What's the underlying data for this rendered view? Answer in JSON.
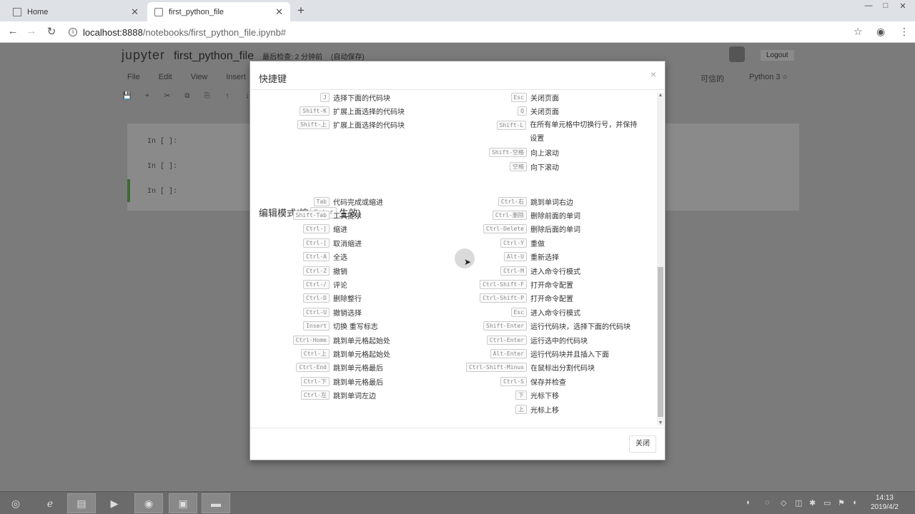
{
  "browser": {
    "tabs": [
      {
        "label": "Home",
        "active": false
      },
      {
        "label": "first_python_file",
        "active": true
      }
    ],
    "new_tab": "+",
    "url_host": "localhost:8888",
    "url_path": "/notebooks/first_python_file.ipynb#",
    "nav": {
      "back": "←",
      "forward": "→",
      "reload": "↻"
    },
    "icons": {
      "star": "☆",
      "account": "◉",
      "menu": "⋮"
    },
    "window_controls": {
      "minimize": "—",
      "maximize": "□",
      "close": "✕"
    }
  },
  "jupyter": {
    "logo": "jupyter",
    "notebook_name": "first_python_file",
    "checkpoint": "最后检查: 2 分钟前",
    "autosave": "(自动保存)",
    "logout": "Logout",
    "menu": [
      "File",
      "Edit",
      "View",
      "Insert"
    ],
    "kernel_status": "可信的",
    "kernel_name": "Python 3",
    "toolbar_icons": [
      "💾",
      "+",
      "✂",
      "⧉",
      "⎘",
      "↑",
      "↓"
    ],
    "cell_prompts": [
      "In [ ]:",
      "In [ ]:",
      "In [ ]:"
    ]
  },
  "modal": {
    "title": "快捷键",
    "close_x": "×",
    "close_button": "关闭",
    "edit_mode_title_prefix": "编辑模式(按",
    "edit_mode_key": "Enter",
    "edit_mode_title_suffix": "生效)",
    "command_left": [
      {
        "key": "J",
        "desc": "选择下面的代码块"
      },
      {
        "key": "Shift-K",
        "desc": "扩展上面选择的代码块"
      },
      {
        "key": "Shift-上",
        "desc": "扩展上面选择的代码块"
      }
    ],
    "command_right": [
      {
        "key": "Esc",
        "desc": "关闭页面"
      },
      {
        "key": "Q",
        "desc": "关闭页面"
      },
      {
        "key": "Shift-L",
        "desc": "在所有单元格中切换行号，并保持设置"
      },
      {
        "key": "Shift-空格",
        "desc": "向上滚动"
      },
      {
        "key": "空格",
        "desc": "向下滚动"
      }
    ],
    "edit_left": [
      {
        "key": "Tab",
        "desc": "代码完成或缩进"
      },
      {
        "key": "Shift-Tab",
        "desc": "工具提示"
      },
      {
        "key": "Ctrl-]",
        "desc": "缩进"
      },
      {
        "key": "Ctrl-[",
        "desc": "取消缩进"
      },
      {
        "key": "Ctrl-A",
        "desc": "全选"
      },
      {
        "key": "Ctrl-Z",
        "desc": "撤销"
      },
      {
        "key": "Ctrl-/",
        "desc": "评论"
      },
      {
        "key": "Ctrl-D",
        "desc": "删除整行"
      },
      {
        "key": "Ctrl-U",
        "desc": "撤销选择"
      },
      {
        "key": "Insert",
        "desc": "切换 重写标志"
      },
      {
        "key": "Ctrl-Home",
        "desc": "跳到单元格起始处"
      },
      {
        "key": "Ctrl-上",
        "desc": "跳到单元格起始处"
      },
      {
        "key": "Ctrl-End",
        "desc": "跳到单元格最后"
      },
      {
        "key": "Ctrl-下",
        "desc": "跳到单元格最后"
      },
      {
        "key": "Ctrl-左",
        "desc": "跳到单词左边"
      }
    ],
    "edit_right": [
      {
        "key": "Ctrl-右",
        "desc": "跳到单词右边"
      },
      {
        "key": "Ctrl-删除",
        "desc": "删除前面的单词"
      },
      {
        "key": "Ctrl-Delete",
        "desc": "删除后面的单词"
      },
      {
        "key": "Ctrl-Y",
        "desc": "重做"
      },
      {
        "key": "Alt-U",
        "desc": "重新选择"
      },
      {
        "key": "Ctrl-M",
        "desc": "进入命令行模式"
      },
      {
        "key": "Ctrl-Shift-F",
        "desc": "打开命令配置"
      },
      {
        "key": "Ctrl-Shift-P",
        "desc": "打开命令配置"
      },
      {
        "key": "Esc",
        "desc": "进入命令行模式"
      },
      {
        "key": "Shift-Enter",
        "desc": "运行代码块，选择下面的代码块"
      },
      {
        "key": "Ctrl-Enter",
        "desc": "运行选中的代码块"
      },
      {
        "key": "Alt-Enter",
        "desc": "运行代码块并且插入下面"
      },
      {
        "key": "Ctrl-Shift-Minus",
        "desc": "在鼠标出分割代码块"
      },
      {
        "key": "Ctrl-S",
        "desc": "保存并检查"
      },
      {
        "key": "下",
        "desc": "光标下移"
      },
      {
        "key": "上",
        "desc": "光标上移"
      }
    ]
  },
  "taskbar": {
    "clock_time": "14:13",
    "clock_date": "2019/4/2"
  }
}
